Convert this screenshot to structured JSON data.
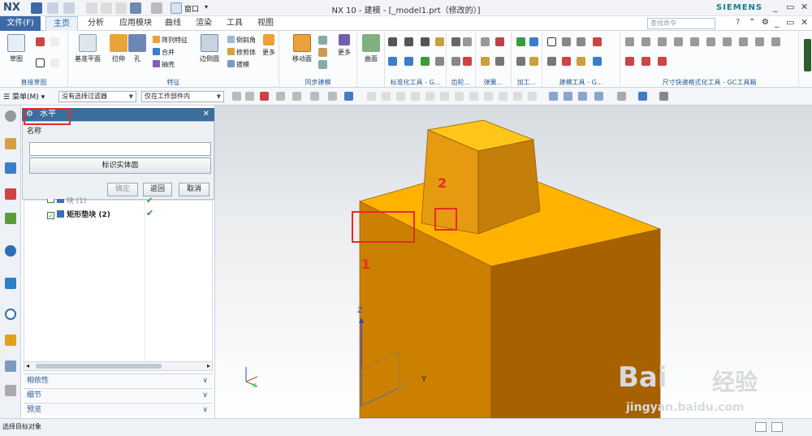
{
  "app": {
    "logo": "NX",
    "title": "NX 10 - 建模 - [_model1.prt（修改的）]",
    "brand": "SIEMENS",
    "window_menu": "窗口"
  },
  "menubar": {
    "file": "文件(F)",
    "tabs": [
      "主页",
      "分析",
      "应用模块",
      "曲线",
      "渲染",
      "工具",
      "视图"
    ],
    "active_tab": "主页",
    "search_placeholder": "查找命令"
  },
  "ribbon": {
    "groups": [
      {
        "label": "直接草图",
        "buttons": [
          "草图"
        ]
      },
      {
        "label": "特征",
        "buttons": [
          "基准平面",
          "拉伸",
          "孔",
          "边倒圆",
          "更多"
        ],
        "small": [
          "阵列特征",
          "合并",
          "抽壳",
          "倒斜角",
          "修剪体",
          "拔模"
        ]
      },
      {
        "label": "同步建模",
        "buttons": [
          "移动面",
          "更多"
        ]
      },
      {
        "label": "",
        "buttons": [
          "曲面"
        ]
      },
      {
        "label": "标准化工具 - G..."
      },
      {
        "label": "齿轮..."
      },
      {
        "label": "弹簧..."
      },
      {
        "label": "加工..."
      },
      {
        "label": "建模工具 - G..."
      },
      {
        "label": "尺寸快速格式化工具 - GC工具箱"
      }
    ]
  },
  "seltool": {
    "menu": "菜单(M)",
    "filter": "没有选择过滤器",
    "scope": "仅在工作部件内"
  },
  "dialog": {
    "title": "水平",
    "name_label": "名称",
    "name_value": "",
    "identify_button": "标识实体面",
    "ok": "确定",
    "back": "返回",
    "cancel": "取消"
  },
  "tree": {
    "rows": [
      {
        "label": "块 (1)"
      },
      {
        "label": "矩形垫块 (2)"
      }
    ]
  },
  "accordion": [
    "相依性",
    "细节",
    "预览"
  ],
  "status": "选择目标对象",
  "annotations": {
    "one": "1",
    "two": "2"
  },
  "axis": {
    "x": "X",
    "y": "Y",
    "z": "Z"
  },
  "watermark": {
    "brand": "Bai",
    "brand_cn": "经验",
    "url": "jingyan.baidu.com"
  },
  "colors": {
    "accent": "#3b6e9c",
    "model_top": "#ffb300",
    "model_front": "#cc8000",
    "model_side": "#a86100",
    "annotation": "#e52b2b"
  }
}
